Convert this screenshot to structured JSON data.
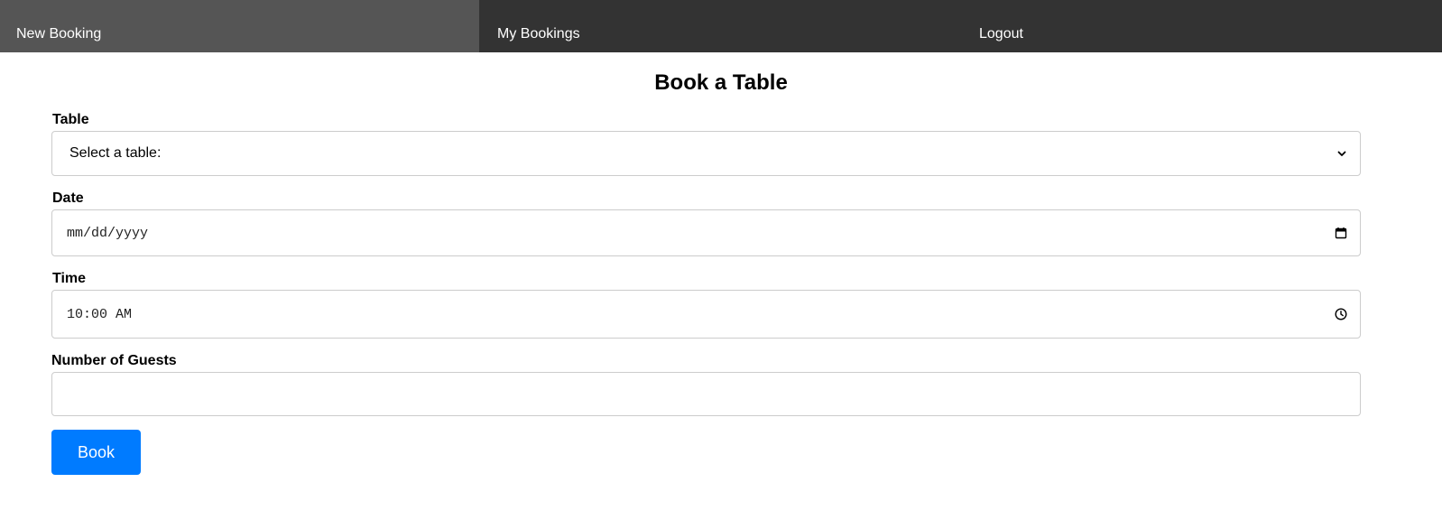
{
  "nav": {
    "items": [
      {
        "label": "New Booking",
        "active": true
      },
      {
        "label": "My Bookings",
        "active": false
      },
      {
        "label": "Logout",
        "active": false
      }
    ]
  },
  "page": {
    "title": "Book a Table"
  },
  "form": {
    "table": {
      "label": "Table",
      "selected": "Select a table:",
      "icon": "chevron-down-icon"
    },
    "date": {
      "label": "Date",
      "value": "mm/dd/yyyy",
      "icon": "calendar-icon"
    },
    "time": {
      "label": "Time",
      "value": "10:00 AM",
      "icon": "clock-icon"
    },
    "guests": {
      "label": "Number of Guests",
      "value": ""
    },
    "submit_label": "Book"
  },
  "colors": {
    "nav_background": "#333333",
    "nav_active": "#555555",
    "button": "#007bff",
    "input_border": "#cccccc"
  }
}
